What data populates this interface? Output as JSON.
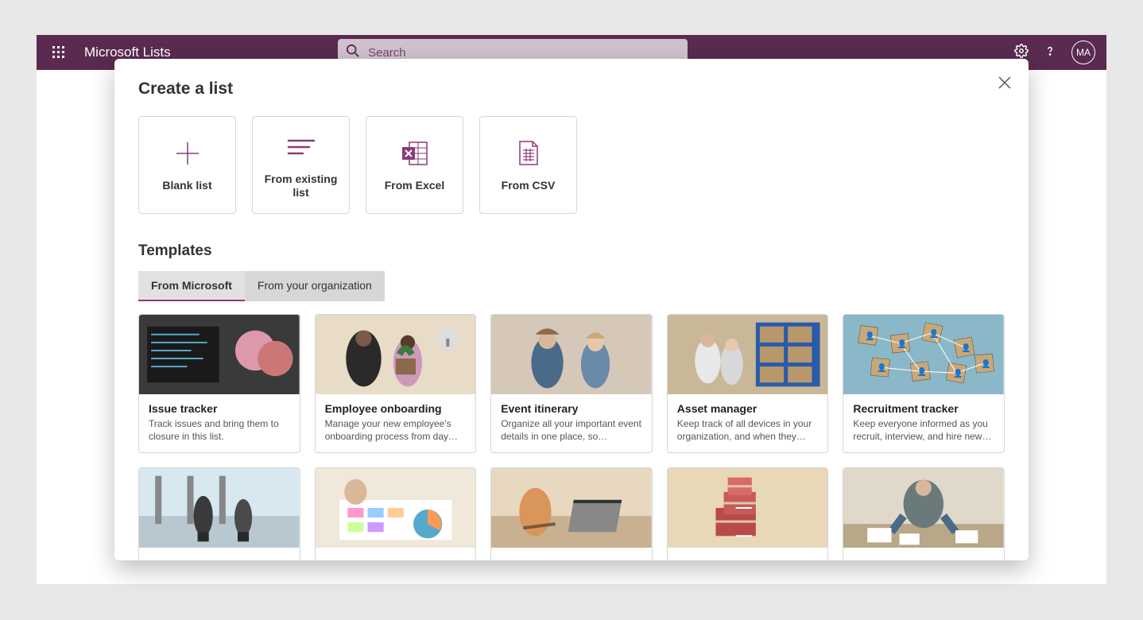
{
  "header": {
    "app_title": "Microsoft Lists",
    "search_placeholder": "Search",
    "avatar_initials": "MA"
  },
  "modal": {
    "title": "Create a list",
    "creation_options": [
      {
        "label": "Blank list",
        "icon": "plus"
      },
      {
        "label": "From existing list",
        "icon": "lines"
      },
      {
        "label": "From Excel",
        "icon": "excel"
      },
      {
        "label": "From CSV",
        "icon": "csv"
      }
    ],
    "templates_heading": "Templates",
    "tabs": [
      {
        "label": "From Microsoft",
        "active": true
      },
      {
        "label": "From your organization",
        "active": false
      }
    ],
    "templates": [
      {
        "title": "Issue tracker",
        "desc": "Track issues and bring them to closure in this list."
      },
      {
        "title": "Employee onboarding",
        "desc": "Manage your new employee's onboarding process from day 1...."
      },
      {
        "title": "Event itinerary",
        "desc": "Organize all your important event details in one place, so everythin…"
      },
      {
        "title": "Asset manager",
        "desc": "Keep track of all devices in your organization, and when they are…"
      },
      {
        "title": "Recruitment tracker",
        "desc": "Keep everyone informed as you recruit, interview, and hire new…"
      },
      {
        "title": "",
        "desc": ""
      },
      {
        "title": "",
        "desc": ""
      },
      {
        "title": "",
        "desc": ""
      },
      {
        "title": "",
        "desc": ""
      },
      {
        "title": "",
        "desc": ""
      }
    ]
  },
  "colors": {
    "brand": "#5a2a50",
    "accent": "#8b3a7a"
  }
}
